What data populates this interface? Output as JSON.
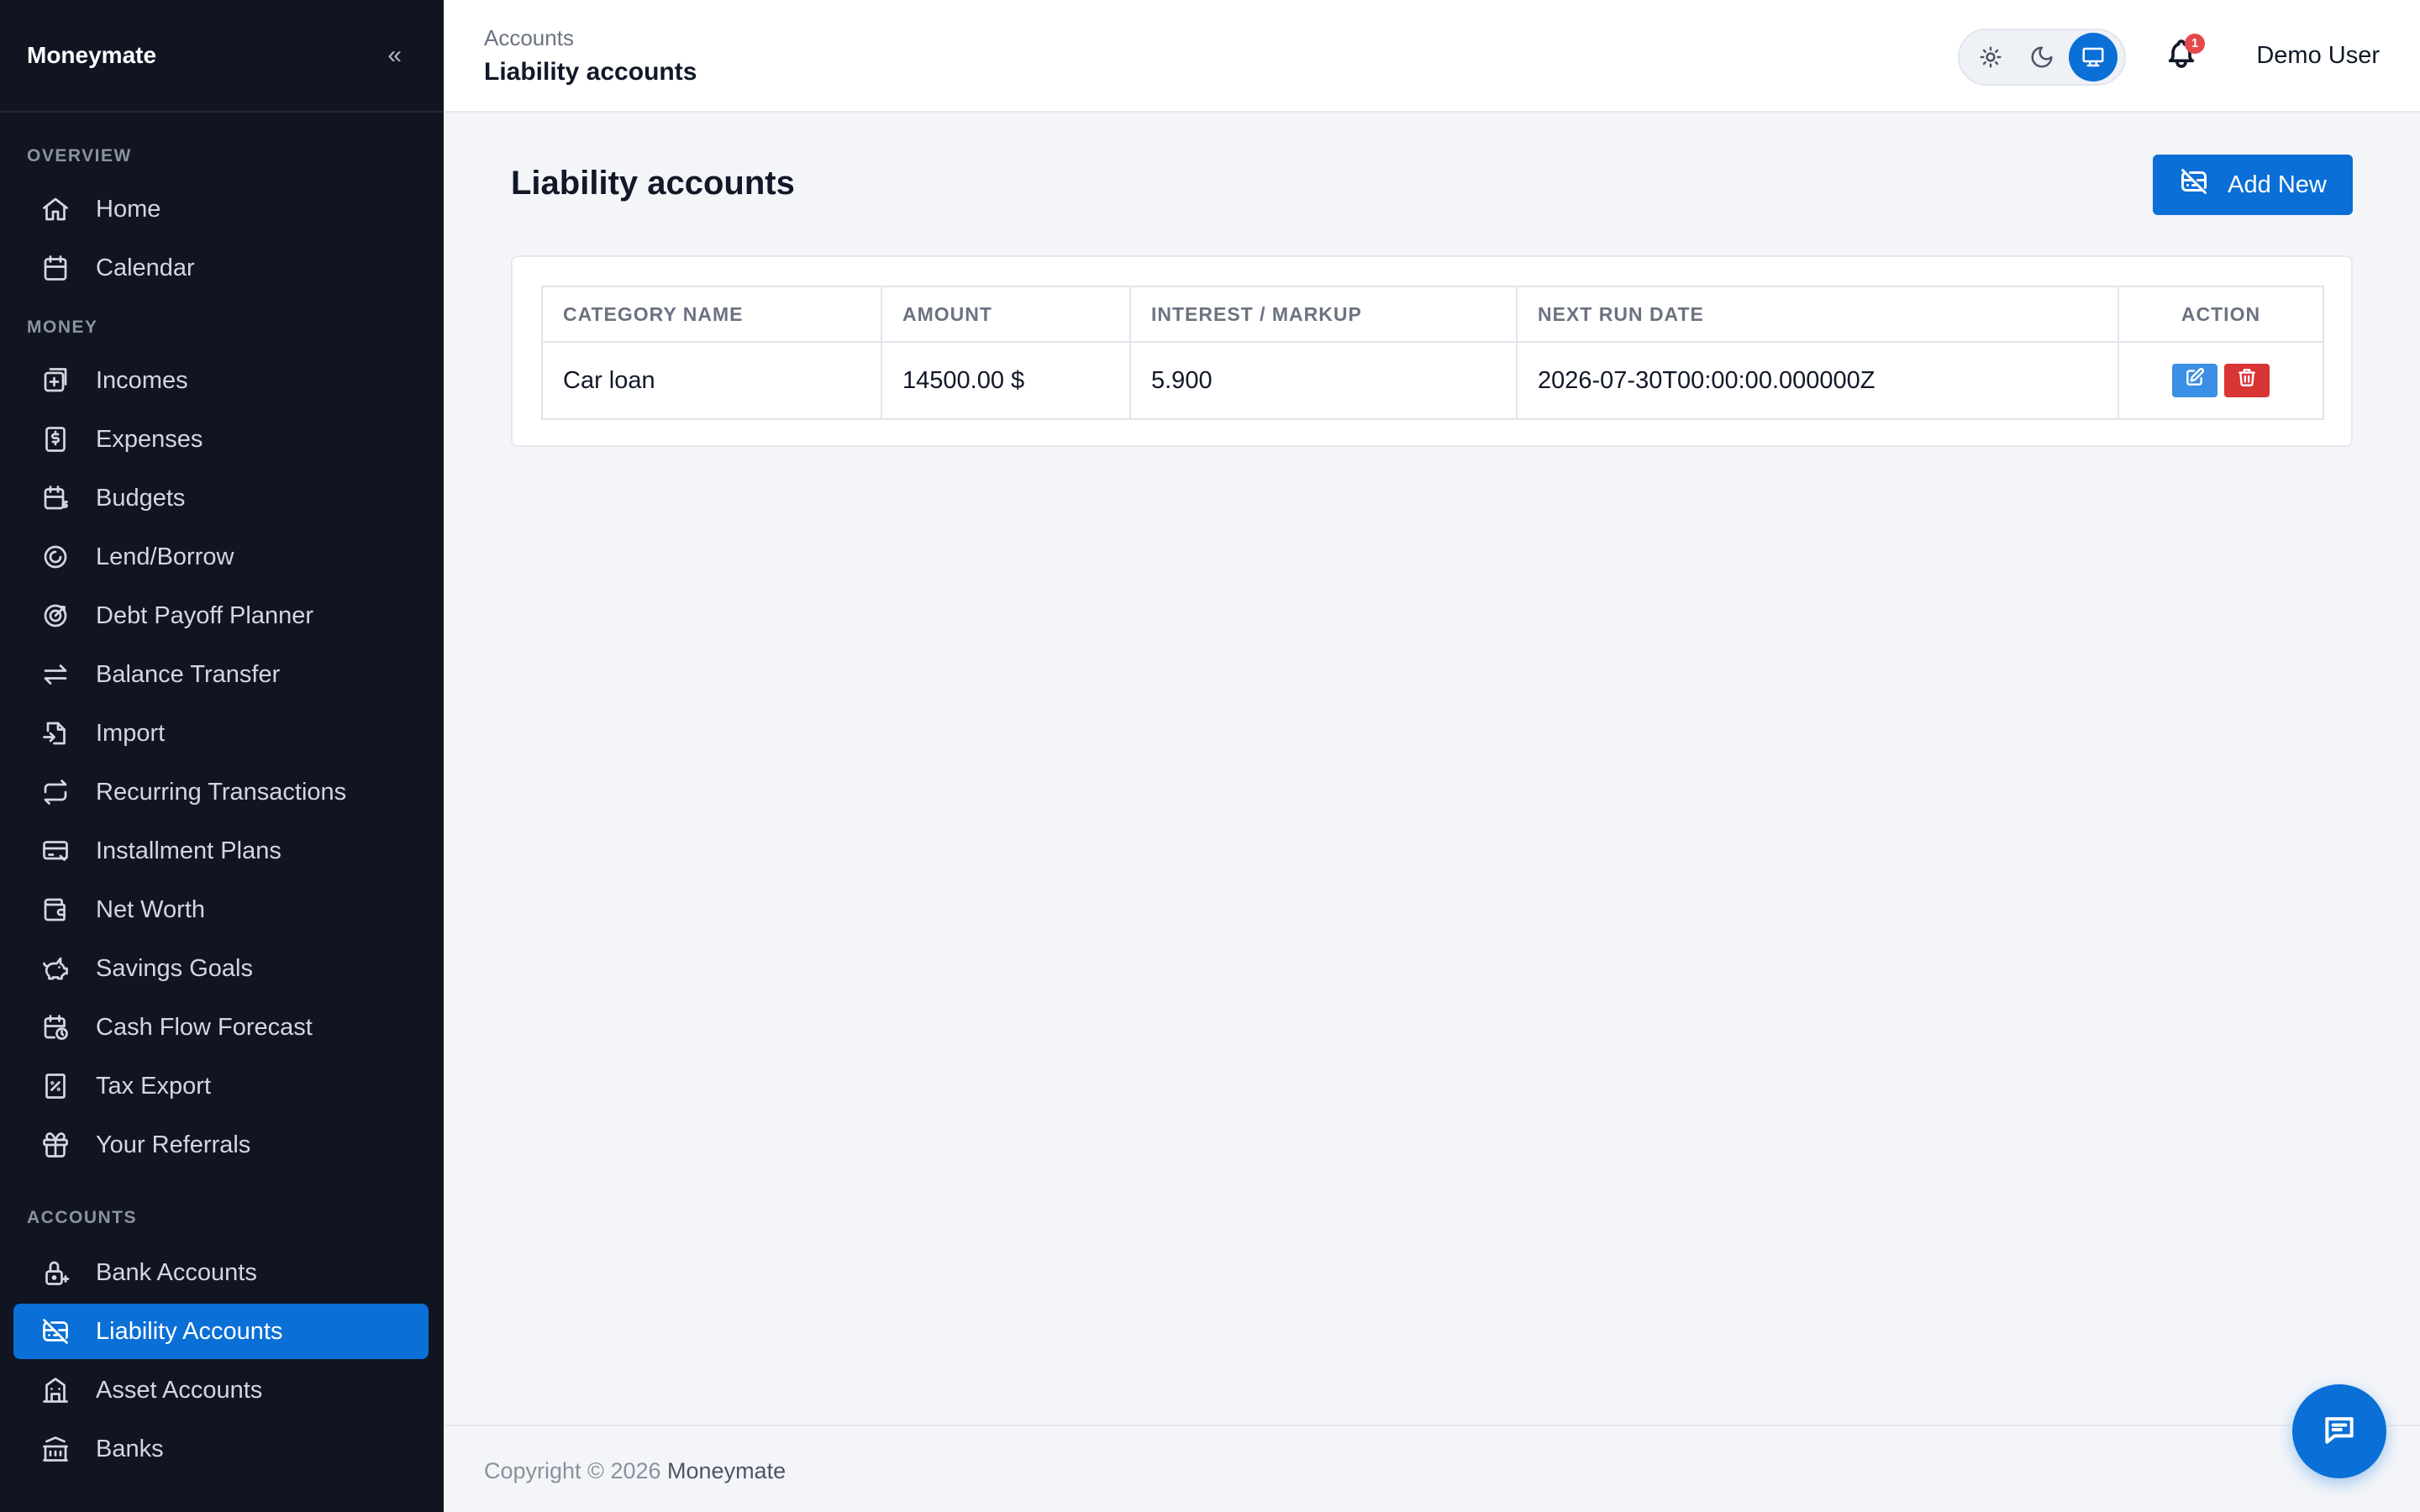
{
  "app": {
    "brand": "Moneymate",
    "collapse_icon": "double-chevron-left-icon"
  },
  "sidebar": {
    "sections": [
      {
        "label": "OVERVIEW",
        "items": [
          {
            "label": "Home",
            "icon": "home-icon"
          },
          {
            "label": "Calendar",
            "icon": "calendar-icon"
          }
        ]
      },
      {
        "label": "MONEY",
        "items": [
          {
            "label": "Incomes",
            "icon": "incomes-icon"
          },
          {
            "label": "Expenses",
            "icon": "expenses-icon"
          },
          {
            "label": "Budgets",
            "icon": "budgets-icon"
          },
          {
            "label": "Lend/Borrow",
            "icon": "lend-borrow-icon"
          },
          {
            "label": "Debt Payoff Planner",
            "icon": "target-icon"
          },
          {
            "label": "Balance Transfer",
            "icon": "transfer-icon"
          },
          {
            "label": "Import",
            "icon": "import-icon"
          },
          {
            "label": "Recurring Transactions",
            "icon": "repeat-icon"
          },
          {
            "label": "Installment Plans",
            "icon": "card-icon"
          },
          {
            "label": "Net Worth",
            "icon": "wallet-icon"
          },
          {
            "label": "Savings Goals",
            "icon": "piggy-bank-icon"
          },
          {
            "label": "Cash Flow Forecast",
            "icon": "calendar-clock-icon"
          },
          {
            "label": "Tax Export",
            "icon": "receipt-icon"
          },
          {
            "label": "Your Referrals",
            "icon": "gift-icon"
          }
        ]
      },
      {
        "label": "ACCOUNTS",
        "items": [
          {
            "label": "Bank Accounts",
            "icon": "lock-icon"
          },
          {
            "label": "Liability Accounts",
            "icon": "credit-card-off-icon",
            "active": true
          },
          {
            "label": "Asset Accounts",
            "icon": "building-icon"
          },
          {
            "label": "Banks",
            "icon": "bank-icon"
          }
        ]
      }
    ]
  },
  "header": {
    "breadcrumb_parent": "Accounts",
    "breadcrumb_current": "Liability accounts",
    "theme_options": [
      "sun-icon",
      "moon-icon",
      "monitor-icon"
    ],
    "theme_selected": "monitor-icon",
    "notification_count": "1",
    "user_name": "Demo User"
  },
  "main": {
    "title": "Liability accounts",
    "add_button_label": "Add New",
    "table": {
      "columns": [
        "CATEGORY NAME",
        "AMOUNT",
        "INTEREST / MARKUP",
        "NEXT RUN DATE",
        "ACTION"
      ],
      "rows": [
        {
          "category_name": "Car loan",
          "amount": "14500.00 $",
          "interest": "5.900",
          "next_run_date": "2026-07-30T00:00:00.000000Z"
        }
      ]
    }
  },
  "footer": {
    "copyright": "Copyright © 2026",
    "brand": "Moneymate"
  },
  "colors": {
    "accent": "#0a6fd6",
    "sidebar_bg": "#111522",
    "danger": "#d93535",
    "edit": "#3b8fe4"
  }
}
